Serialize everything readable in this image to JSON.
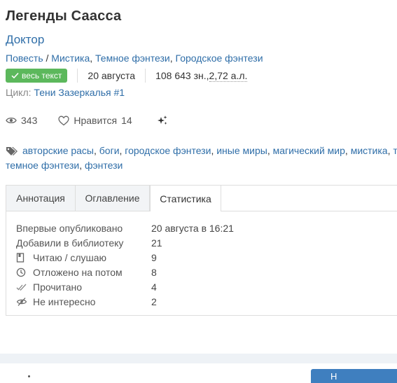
{
  "book": {
    "title": "Легенды Саасса",
    "author": "Доктор",
    "form": "Повесть",
    "genre_sep": " / ",
    "genres": [
      "Мистика",
      "Темное фэнтези",
      "Городское фэнтези"
    ],
    "genre_comma": ", ",
    "full_text_badge": "весь текст",
    "date": "20 августа",
    "size_chars": "108 643 зн., ",
    "size_al": "2,72 а.л.",
    "cycle_label": "Цикл: ",
    "cycle_name": "Тени Зазеркалья #1"
  },
  "stats_bar": {
    "views": "343",
    "likes_label": "Нравится",
    "likes": "14"
  },
  "tags": {
    "line1": [
      "авторские расы",
      "боги",
      "городское фэнтези",
      "иные миры",
      "магический мир",
      "мистика",
      "т"
    ],
    "line2": [
      "темное фэнтези",
      "фэнтези"
    ],
    "sep": ", "
  },
  "tabs": [
    {
      "label": "Аннотация",
      "active": false
    },
    {
      "label": "Оглавление",
      "active": false
    },
    {
      "label": "Статистика",
      "active": true
    }
  ],
  "statistics": [
    {
      "label": "Впервые опубликовано",
      "value": "20 августа в 16:21",
      "icon": ""
    },
    {
      "label": "Добавили в библиотеку",
      "value": "21",
      "icon": ""
    },
    {
      "label": "Читаю / слушаю",
      "value": "9",
      "icon": "bookmark-icon"
    },
    {
      "label": "Отложено на потом",
      "value": "8",
      "icon": "clock-icon"
    },
    {
      "label": "Прочитано",
      "value": "4",
      "icon": "double-check-icon"
    },
    {
      "label": "Не интересно",
      "value": "2",
      "icon": "eye-off-icon"
    }
  ],
  "bottom": {
    "button_label": "Н"
  },
  "colors": {
    "link": "#2f6ea8",
    "badge": "#5cb85c",
    "button": "#3f7fbf"
  }
}
